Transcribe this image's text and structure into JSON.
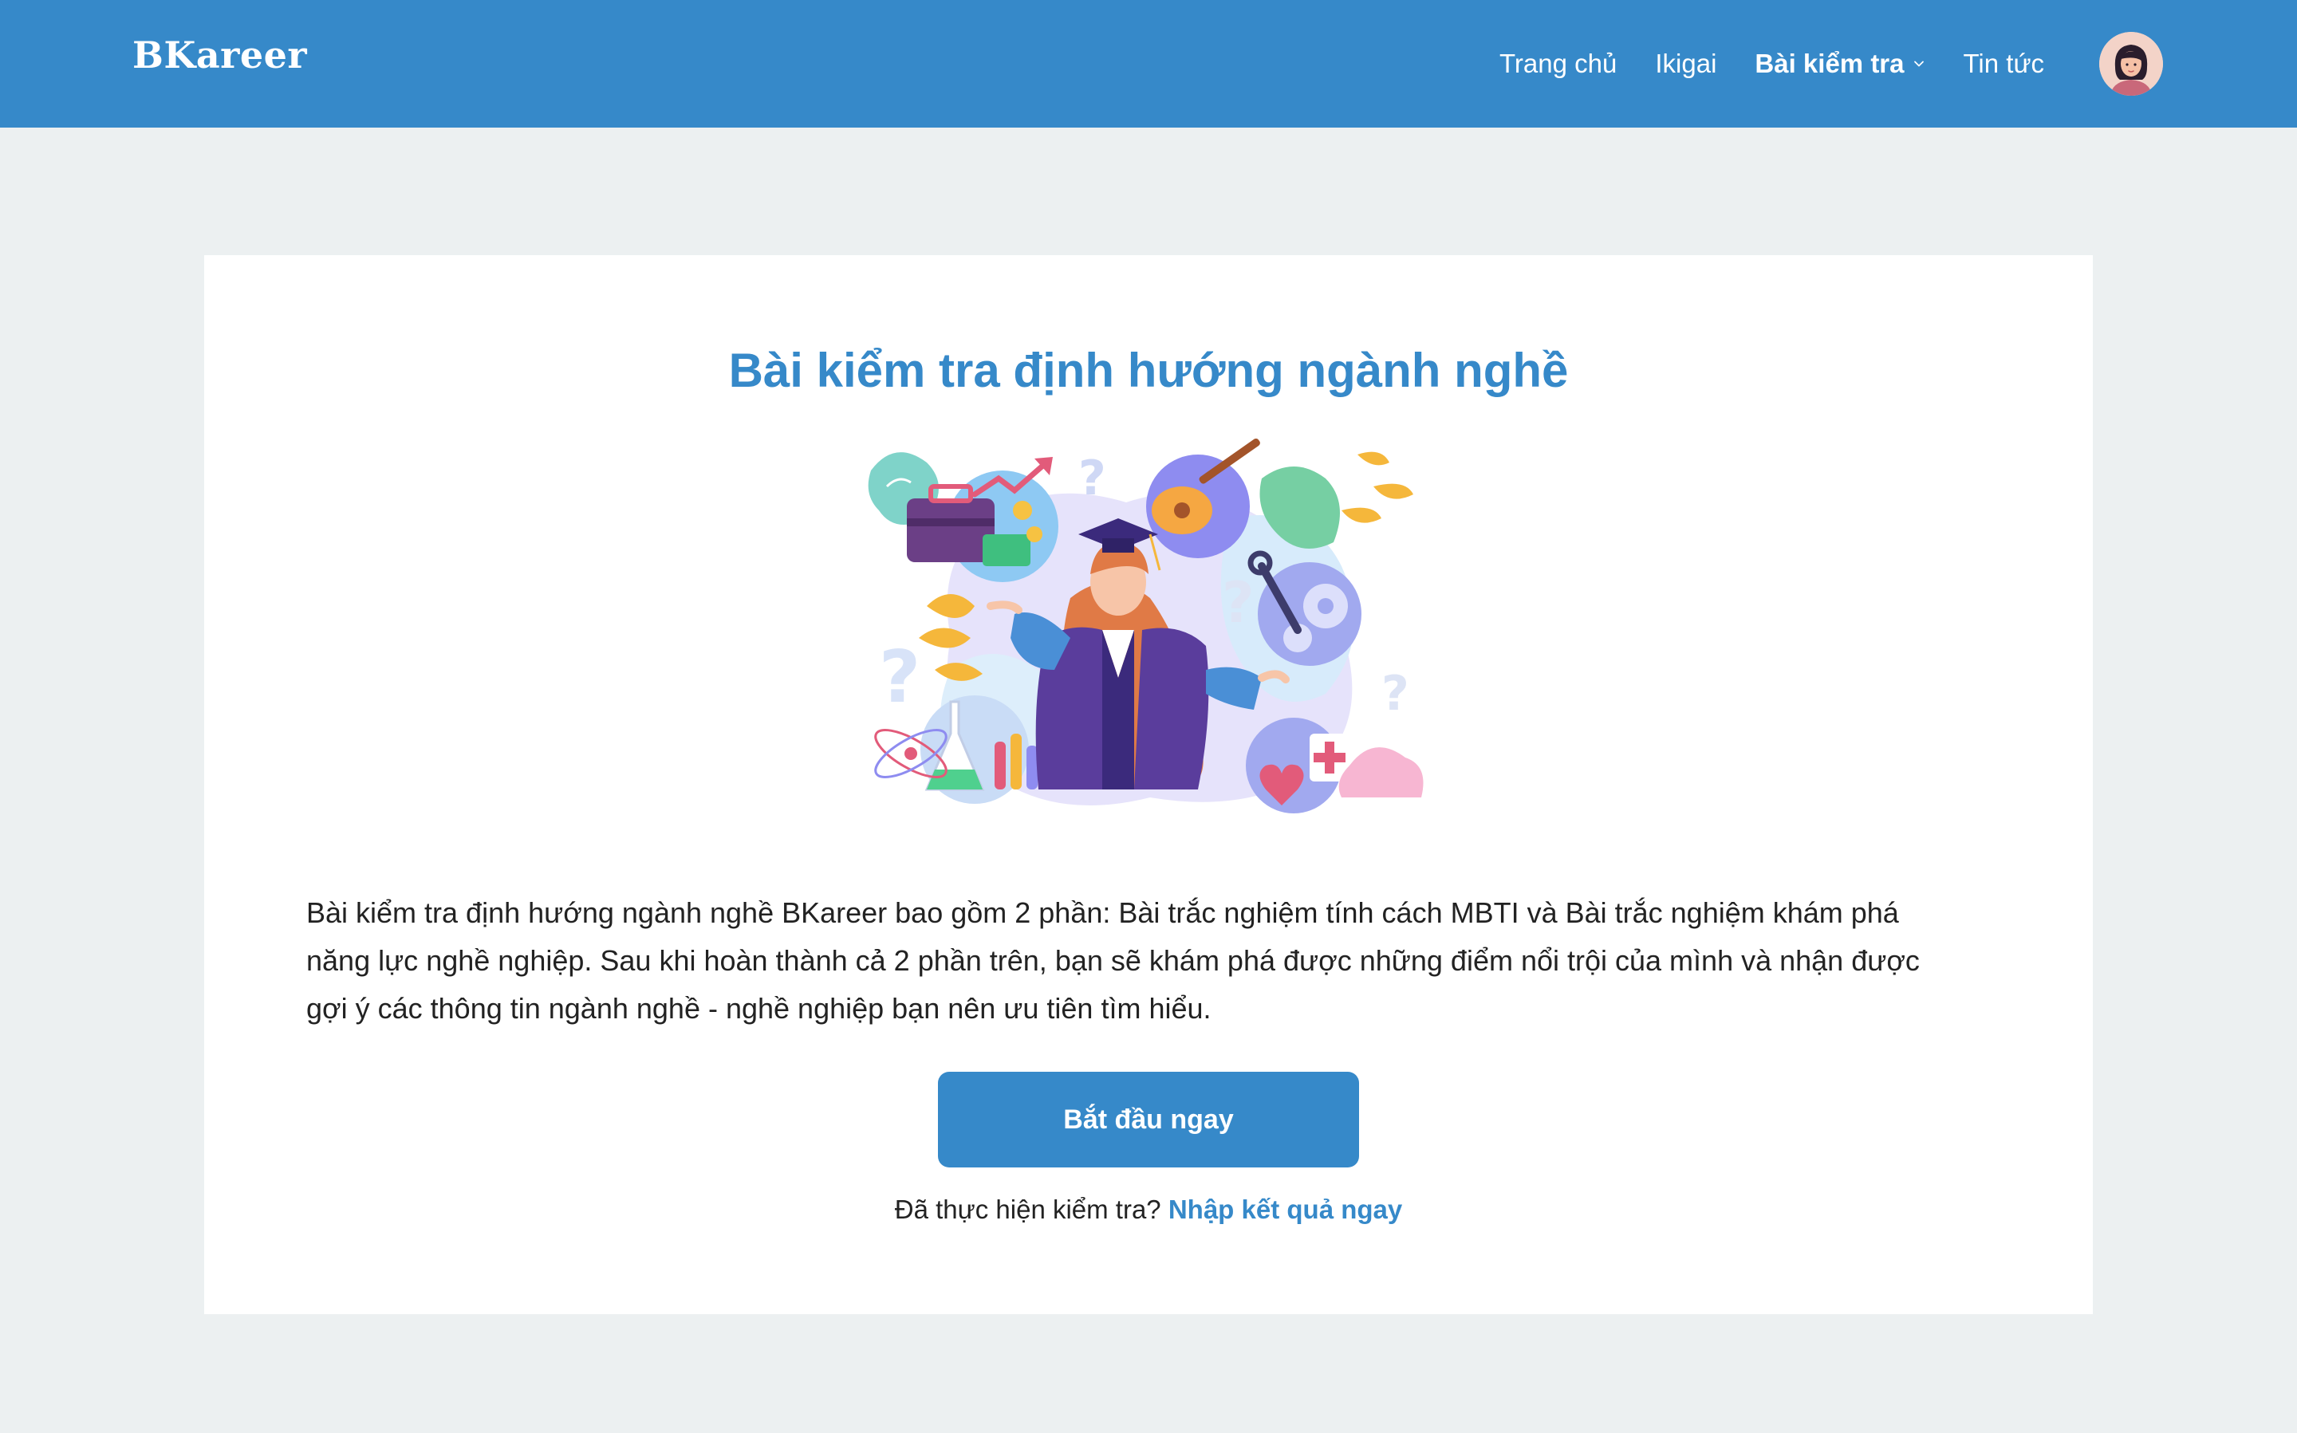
{
  "header": {
    "logo": "BKareer",
    "nav": [
      {
        "label": "Trang chủ"
      },
      {
        "label": "Ikigai"
      },
      {
        "label": "Bài kiểm tra",
        "active": true,
        "has_dropdown": true
      },
      {
        "label": "Tin tức"
      }
    ],
    "avatar_icon": "user-avatar-icon"
  },
  "main": {
    "title": "Bài kiểm tra định hướng ngành nghề",
    "illustration_icon": "graduate-career-illustration",
    "description": "Bài kiểm tra định hướng ngành nghề BKareer bao gồm 2 phần: Bài trắc nghiệm tính cách MBTI và Bài trắc nghiệm khám phá năng lực nghề nghiệp. Sau khi hoàn thành cả 2 phần trên, bạn sẽ khám phá được những điểm nổi trội của mình và nhận được gợi ý các thông tin ngành nghề - nghề nghiệp bạn nên ưu tiên tìm hiểu.",
    "start_button": "Bắt đầu ngay",
    "already_text": "Đã thực hiện kiểm tra?",
    "already_link": "Nhập kết quả ngay"
  },
  "colors": {
    "primary": "#3689c9",
    "background": "#ecf0f1",
    "card": "#ffffff",
    "text": "#222222"
  }
}
